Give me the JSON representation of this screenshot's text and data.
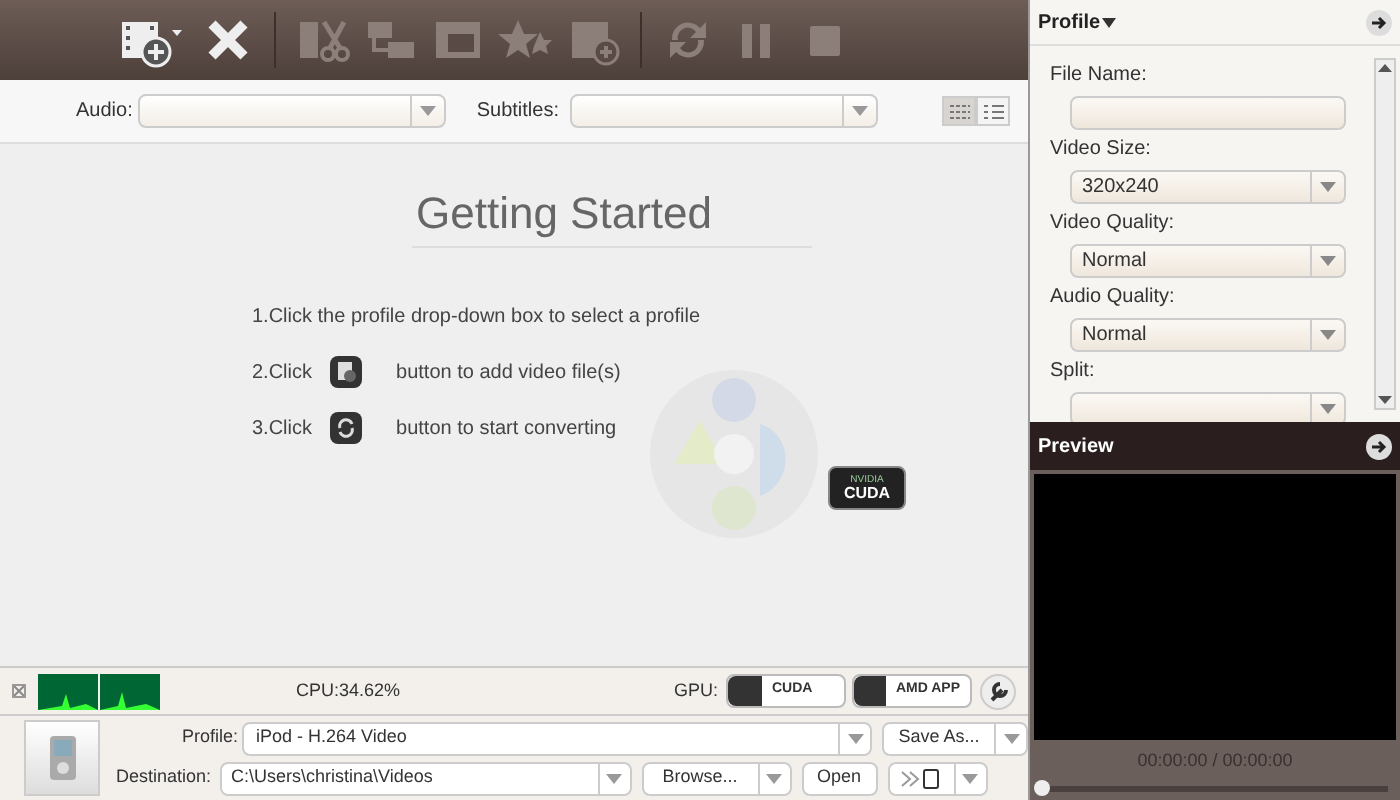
{
  "toolbar": {
    "buttons": [
      {
        "kind": "add-video",
        "disabled": false
      },
      {
        "kind": "remove",
        "disabled": false
      },
      {
        "kind": "trim",
        "disabled": true
      },
      {
        "kind": "merge",
        "disabled": true
      },
      {
        "kind": "stereo",
        "disabled": true
      },
      {
        "kind": "effect",
        "disabled": true
      },
      {
        "kind": "watermark",
        "disabled": true
      },
      {
        "kind": "convert",
        "disabled": true
      },
      {
        "kind": "pause",
        "disabled": true
      },
      {
        "kind": "stop",
        "disabled": true
      }
    ]
  },
  "track_bar": {
    "audio_label": "Audio:",
    "subtitles_label": "Subtitles:",
    "views": [
      {
        "kind": "grid",
        "selected": true
      },
      {
        "kind": "list",
        "selected": false
      }
    ]
  },
  "getting_started": {
    "title": "Getting Started",
    "steps": [
      {
        "kind": "text",
        "text": "1.Click the profile drop-down box to select a profile"
      },
      {
        "kind": "add",
        "prefix": "2.Click",
        "suffix": "button to add video file(s)"
      },
      {
        "kind": "convert",
        "prefix": "3.Click",
        "suffix": "button to start converting"
      }
    ],
    "badge": {
      "brand": "NVIDIA",
      "name": "CUDA"
    }
  },
  "status": {
    "cpu": "CPU:34.62%",
    "gpu_label": "GPU:",
    "gpu_buttons": [
      "CUDA",
      "AMD APP"
    ]
  },
  "output": {
    "profile_label": "Profile:",
    "profile": "iPod - H.264 Video",
    "save_as": "Save As...",
    "destination_label": "Destination:",
    "destination": "C:\\Users\\christina\\Videos",
    "browse": "Browse...",
    "open": "Open"
  },
  "profile_panel": {
    "title": "Profile",
    "fields": [
      {
        "label": "File Name:",
        "kind": "text"
      },
      {
        "label": "Video Size:",
        "kind": "select",
        "value": "320x240"
      },
      {
        "label": "Video Quality:",
        "kind": "select",
        "value": "Normal"
      },
      {
        "label": "Audio Quality:",
        "kind": "select",
        "value": "Normal"
      },
      {
        "label": "Split:",
        "kind": "cut"
      }
    ]
  },
  "preview": {
    "title": "Preview",
    "time": "00:00:00 / 00:00:00",
    "level": 0
  }
}
